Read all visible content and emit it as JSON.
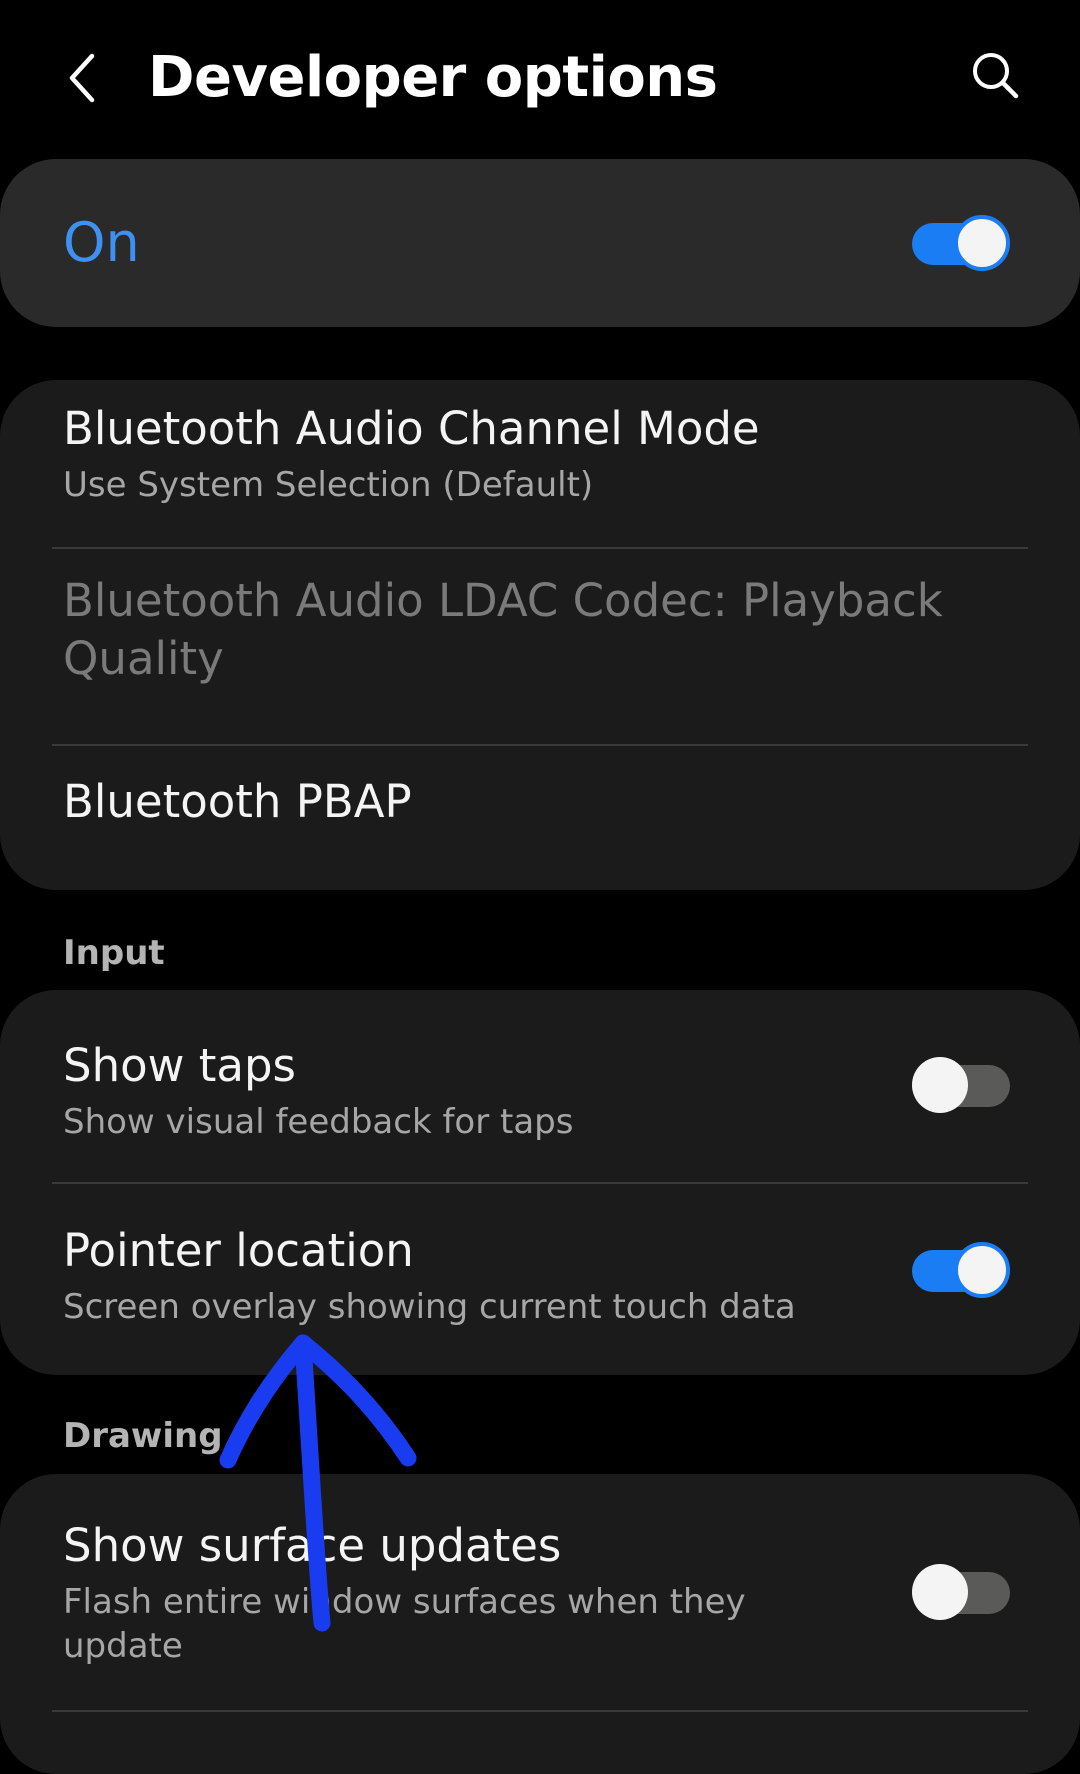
{
  "header": {
    "title": "Developer options",
    "back_icon": "chevron-left-icon",
    "search_icon": "search-icon"
  },
  "master": {
    "label": "On",
    "enabled": true,
    "accent_color": "#1a7df4"
  },
  "bluetooth_group": {
    "items": [
      {
        "title": "Bluetooth Audio Channel Mode",
        "subtitle": "Use System Selection (Default)",
        "enabled": true
      },
      {
        "title": "Bluetooth Audio LDAC Codec: Playback Quality",
        "enabled": false
      },
      {
        "title": "Bluetooth PBAP",
        "enabled": true
      }
    ]
  },
  "sections": {
    "input": "Input",
    "drawing": "Drawing"
  },
  "input_group": {
    "items": [
      {
        "title": "Show taps",
        "subtitle": "Show visual feedback for taps",
        "toggle": false
      },
      {
        "title": "Pointer location",
        "subtitle": "Screen overlay showing current touch data",
        "toggle": true
      }
    ]
  },
  "drawing_group": {
    "items": [
      {
        "title": "Show surface updates",
        "subtitle": "Flash entire window surfaces when they update",
        "toggle": false
      }
    ]
  },
  "annotation": {
    "type": "hand-drawn-arrow",
    "color": "#1a3cf0",
    "points_to": "Pointer location"
  }
}
